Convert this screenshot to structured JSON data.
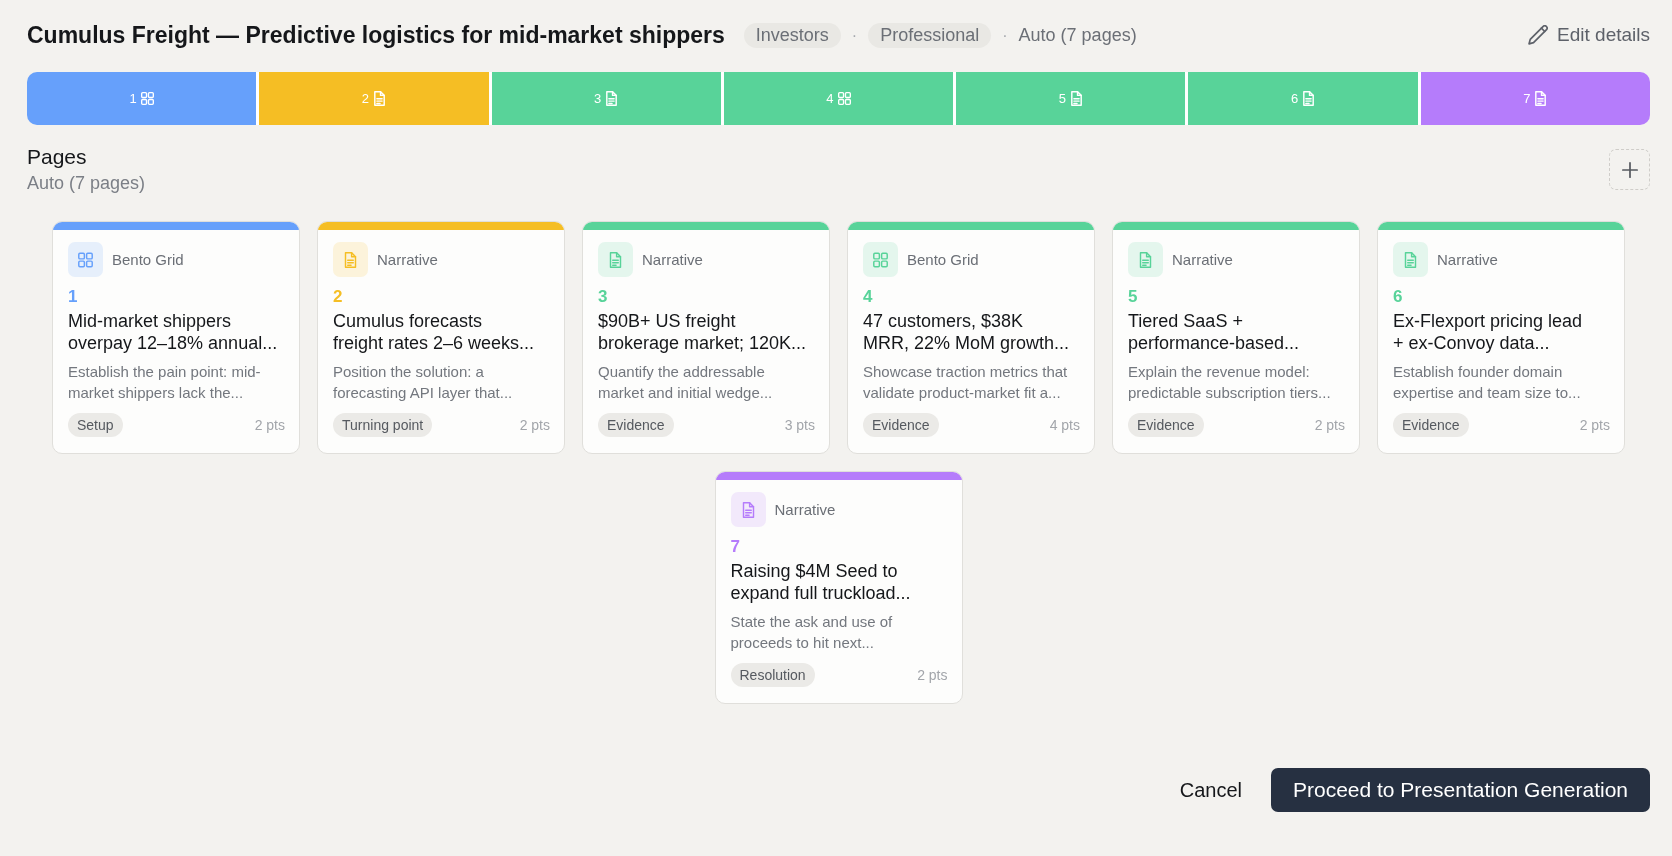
{
  "header": {
    "title": "Cumulus Freight — Predictive logistics for mid-market shippers",
    "meta": [
      {
        "kind": "tag",
        "text": "Investors"
      },
      {
        "kind": "separator",
        "text": "·"
      },
      {
        "kind": "tag",
        "text": "Professional"
      },
      {
        "kind": "separator",
        "text": "·"
      },
      {
        "kind": "plain",
        "text": "Auto (7 pages)"
      }
    ],
    "edit_button": "Edit details"
  },
  "bar_segments": [
    {
      "number": "1",
      "kind": "bento",
      "color": "#66a0fb"
    },
    {
      "number": "2",
      "kind": "narrative",
      "color": "#f5be24"
    },
    {
      "number": "3",
      "kind": "narrative",
      "color": "#58d399"
    },
    {
      "number": "4",
      "kind": "bento",
      "color": "#58d399"
    },
    {
      "number": "5",
      "kind": "narrative",
      "color": "#58d399"
    },
    {
      "number": "6",
      "kind": "narrative",
      "color": "#58d399"
    },
    {
      "number": "7",
      "kind": "narrative",
      "color": "#b57cfb"
    }
  ],
  "pages_section": {
    "heading": "Pages",
    "subtitle": "Auto (7 pages)"
  },
  "pages": [
    {
      "kind": "bento",
      "type_label": "Bento Grid",
      "number": "1",
      "color": "#66a0fb",
      "title": "Mid-market shippers\noverpay 12–18% annual...",
      "description": "Establish the pain point: mid-\nmarket shippers lack the...",
      "tag": "Setup",
      "points": "2 pts"
    },
    {
      "kind": "narrative",
      "type_label": "Narrative",
      "number": "2",
      "color": "#f5be24",
      "title": "Cumulus forecasts\nfreight rates 2–6 weeks...",
      "description": "Position the solution: a\nforecasting API layer that...",
      "tag": "Turning point",
      "points": "2 pts"
    },
    {
      "kind": "narrative",
      "type_label": "Narrative",
      "number": "3",
      "color": "#58d399",
      "title": "$90B+ US freight\nbrokerage market; 120K...",
      "description": "Quantify the addressable\nmarket and initial wedge...",
      "tag": "Evidence",
      "points": "3 pts"
    },
    {
      "kind": "bento",
      "type_label": "Bento Grid",
      "number": "4",
      "color": "#58d399",
      "title": "47 customers, $38K\nMRR, 22% MoM growth...",
      "description": "Showcase traction metrics that\nvalidate product-market fit a...",
      "tag": "Evidence",
      "points": "4 pts"
    },
    {
      "kind": "narrative",
      "type_label": "Narrative",
      "number": "5",
      "color": "#58d399",
      "title": "Tiered SaaS +\nperformance-based...",
      "description": "Explain the revenue model:\npredictable subscription tiers...",
      "tag": "Evidence",
      "points": "2 pts"
    },
    {
      "kind": "narrative",
      "type_label": "Narrative",
      "number": "6",
      "color": "#58d399",
      "title": "Ex-Flexport pricing lead\n+ ex-Convoy data...",
      "description": "Establish founder domain\nexpertise and team size to...",
      "tag": "Evidence",
      "points": "2 pts"
    },
    {
      "kind": "narrative",
      "type_label": "Narrative",
      "number": "7",
      "color": "#b57cfb",
      "title": "Raising $4M Seed to\nexpand full truckload...",
      "description": "State the ask and use of\nproceeds to hit next...",
      "tag": "Resolution",
      "points": "2 pts"
    }
  ],
  "footer": {
    "cancel": "Cancel",
    "proceed": "Proceed to Presentation Generation"
  }
}
